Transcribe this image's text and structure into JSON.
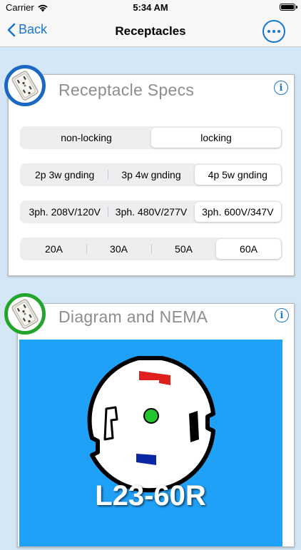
{
  "status_bar": {
    "carrier": "Carrier",
    "time": "5:34 AM"
  },
  "nav": {
    "back_label": "Back",
    "title": "Receptacles"
  },
  "specs_card": {
    "title": "Receptacle Specs",
    "segments": [
      {
        "options": [
          "non-locking",
          "locking"
        ],
        "selected": 1
      },
      {
        "options": [
          "2p 3w gnding",
          "3p 4w gnding",
          "4p 5w gnding"
        ],
        "selected": 2
      },
      {
        "options": [
          "3ph. 208V/120V",
          "3ph. 480V/277V",
          "3ph. 600V/347V"
        ],
        "selected": 2
      },
      {
        "options": [
          "20A",
          "30A",
          "50A",
          "60A"
        ],
        "selected": 3
      }
    ]
  },
  "diagram_card": {
    "title": "Diagram and NEMA",
    "nema_label": "L23-60R",
    "colors": {
      "background": "#1fa1f8",
      "hot_red": "#e0201e",
      "hot_blue": "#0a27a6",
      "ground": "#21c52e",
      "hot_black": "#000000"
    }
  },
  "icons": {
    "back": "chevron-left-icon",
    "more": "ellipsis-circle-icon",
    "info": "info-circle-icon",
    "receptacle": "receptacle-outlet-icon"
  },
  "accent_color": "#1a75d2"
}
